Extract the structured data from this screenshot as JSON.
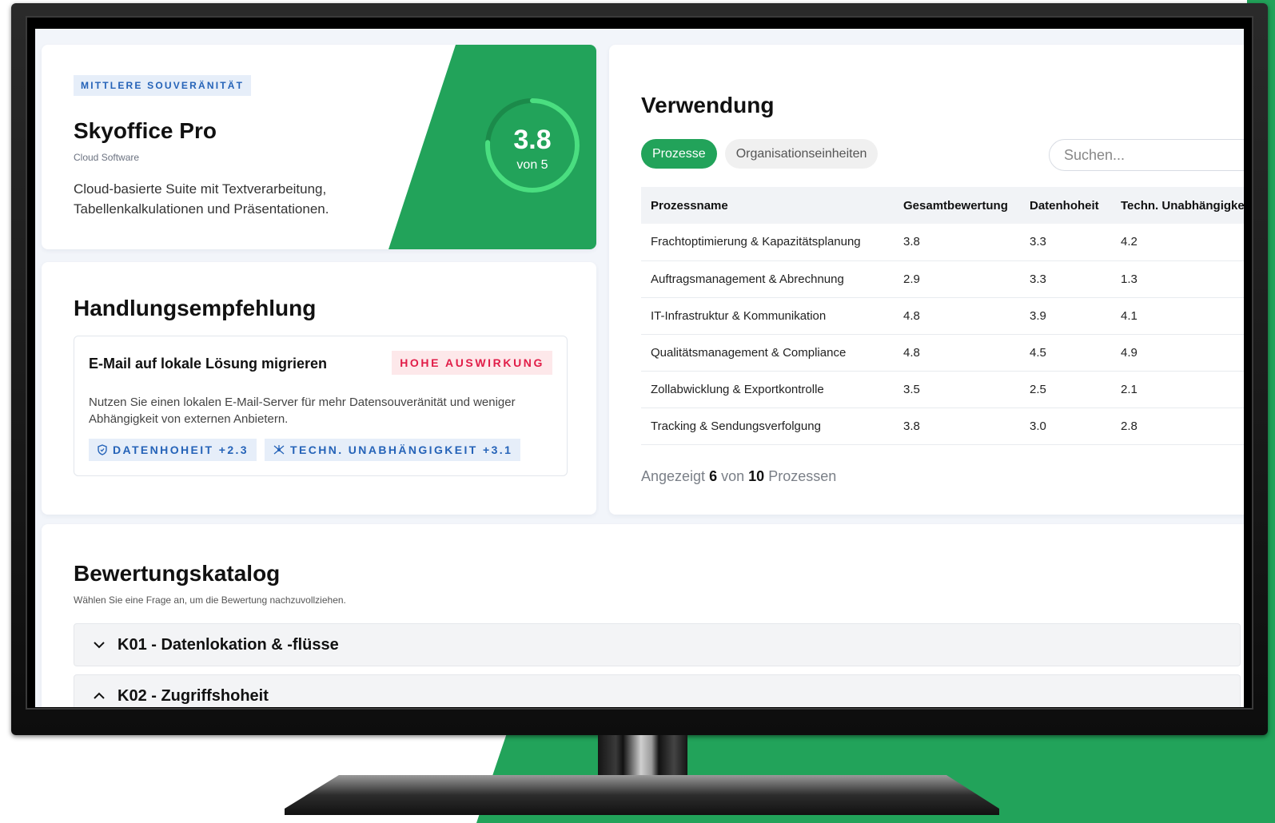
{
  "colors": {
    "accent": "#22a35a",
    "accent_dark": "#1f9a55",
    "badge_bg": "#e6eef9",
    "badge_text": "#2563b8",
    "impact_text": "#e11d48"
  },
  "product": {
    "sovereignty_badge": "MITTLERE SOUVERÄNITÄT",
    "name": "Skyoffice Pro",
    "category": "Cloud Software",
    "description": "Cloud-basierte Suite mit Textverarbeitung, Tabellenkalkulationen und Präsentationen.",
    "score": "3.8",
    "score_of": "von 5",
    "score_fraction": 0.76
  },
  "recommendation": {
    "title": "Handlungsempfehlung",
    "item": {
      "title": "E-Mail auf lokale Lösung migrieren",
      "impact": "HOHE AUSWIRKUNG",
      "text": "Nutzen Sie einen lokalen E-Mail-Server für mehr Datensouveränität und weniger Abhängigkeit von externen Anbietern.",
      "chips": [
        {
          "icon": "shield-icon",
          "label": "DATENHOHEIT +2.3"
        },
        {
          "icon": "network-icon",
          "label": "TECHN. UNABHÄNGIGKEIT +3.1"
        }
      ]
    }
  },
  "usage": {
    "title": "Verwendung",
    "tabs": [
      {
        "label": "Prozesse",
        "active": true
      },
      {
        "label": "Organisationseinheiten",
        "active": false
      }
    ],
    "search_placeholder": "Suchen...",
    "columns": [
      "Prozessname",
      "Gesamtbewertung",
      "Datenhoheit",
      "Techn. Unabhängigkei"
    ],
    "rows": [
      [
        "Frachtoptimierung & Kapazitätsplanung",
        "3.8",
        "3.3",
        "4.2"
      ],
      [
        "Auftragsmanagement & Abrechnung",
        "2.9",
        "3.3",
        "1.3"
      ],
      [
        "IT-Infrastruktur & Kommunikation",
        "4.8",
        "3.9",
        "4.1"
      ],
      [
        "Qualitätsmanagement & Compliance",
        "4.8",
        "4.5",
        "4.9"
      ],
      [
        "Zollabwicklung & Exportkontrolle",
        "3.5",
        "2.5",
        "2.1"
      ],
      [
        "Tracking & Sendungsverfolgung",
        "3.8",
        "3.0",
        "2.8"
      ]
    ],
    "footer": {
      "prefix": "Angezeigt",
      "shown": "6",
      "mid": "von",
      "total": "10",
      "suffix": "Prozessen"
    }
  },
  "catalog": {
    "title": "Bewertungskatalog",
    "subtitle": "Wählen Sie eine Frage an, um die Bewertung nachzuvollziehen.",
    "items": [
      {
        "label": "K01 - Datenlokation & -flüsse",
        "icon": "chevron-down-icon"
      },
      {
        "label": "K02 - Zugriffshoheit",
        "icon": "chevron-up-icon"
      }
    ]
  }
}
